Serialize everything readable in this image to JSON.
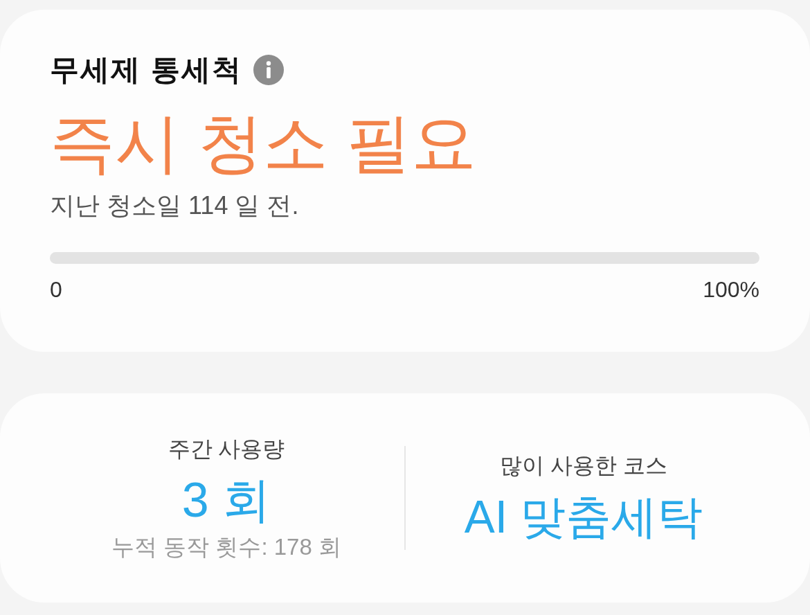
{
  "filter_card": {
    "title": "무세제 통세척",
    "status": "즉시 청소 필요",
    "last_cleaned": "지난 청소일 114 일 전.",
    "progress": {
      "level": 0,
      "min_label": "0",
      "max_label": "100%"
    }
  },
  "usage_card": {
    "stats": [
      {
        "label": "주간 사용량",
        "value": "3 회",
        "note": "누적 동작 횟수: 178 회"
      },
      {
        "label": "많이 사용한 코스",
        "value": "AI 맞춤세탁"
      }
    ]
  }
}
